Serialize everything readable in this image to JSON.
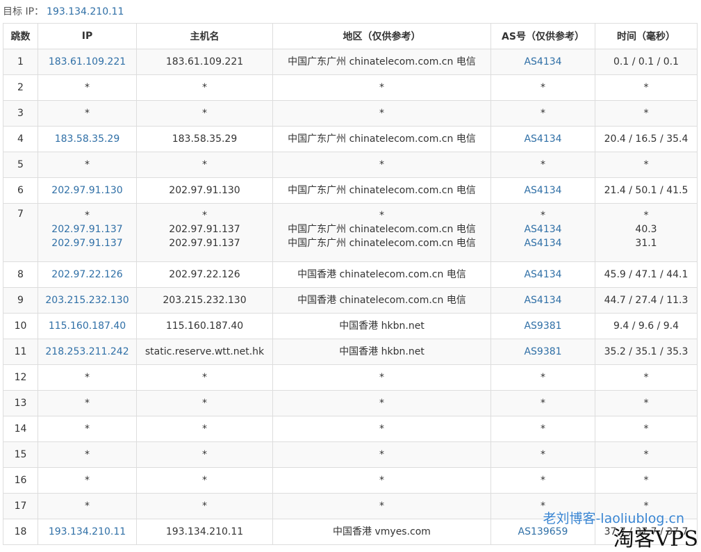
{
  "target": {
    "label": "目标 IP：",
    "ip": "193.134.210.11"
  },
  "table": {
    "headers": [
      "跳数",
      "IP",
      "主机名",
      "地区（仅供参考）",
      "AS号（仅供参考）",
      "时间（毫秒）"
    ],
    "rows": [
      {
        "hop": "1",
        "lines": [
          {
            "ip": "183.61.109.221",
            "host": "183.61.109.221",
            "region": "中国广东广州 chinatelecom.com.cn 电信",
            "as": "AS4134",
            "time": "0.1 / 0.1 / 0.1"
          }
        ]
      },
      {
        "hop": "2",
        "lines": [
          {
            "ip": "*",
            "host": "*",
            "region": "*",
            "as": "*",
            "time": "*"
          }
        ]
      },
      {
        "hop": "3",
        "lines": [
          {
            "ip": "*",
            "host": "*",
            "region": "*",
            "as": "*",
            "time": "*"
          }
        ]
      },
      {
        "hop": "4",
        "lines": [
          {
            "ip": "183.58.35.29",
            "host": "183.58.35.29",
            "region": "中国广东广州 chinatelecom.com.cn 电信",
            "as": "AS4134",
            "time": "20.4 / 16.5 / 35.4"
          }
        ]
      },
      {
        "hop": "5",
        "lines": [
          {
            "ip": "*",
            "host": "*",
            "region": "*",
            "as": "*",
            "time": "*"
          }
        ]
      },
      {
        "hop": "6",
        "lines": [
          {
            "ip": "202.97.91.130",
            "host": "202.97.91.130",
            "region": "中国广东广州 chinatelecom.com.cn 电信",
            "as": "AS4134",
            "time": "21.4 / 50.1 / 41.5"
          }
        ]
      },
      {
        "hop": "7",
        "lines": [
          {
            "ip": "*",
            "host": "*",
            "region": "*",
            "as": "*",
            "time": "*"
          },
          {
            "ip": "202.97.91.137",
            "host": "202.97.91.137",
            "region": "中国广东广州 chinatelecom.com.cn 电信",
            "as": "AS4134",
            "time": "40.3"
          },
          {
            "ip": "202.97.91.137",
            "host": "202.97.91.137",
            "region": "中国广东广州 chinatelecom.com.cn 电信",
            "as": "AS4134",
            "time": "31.1"
          }
        ]
      },
      {
        "hop": "8",
        "lines": [
          {
            "ip": "202.97.22.126",
            "host": "202.97.22.126",
            "region": "中国香港 chinatelecom.com.cn 电信",
            "as": "AS4134",
            "time": "45.9 / 47.1 / 44.1"
          }
        ]
      },
      {
        "hop": "9",
        "lines": [
          {
            "ip": "203.215.232.130",
            "host": "203.215.232.130",
            "region": "中国香港 chinatelecom.com.cn 电信",
            "as": "AS4134",
            "time": "44.7 / 27.4 / 11.3"
          }
        ]
      },
      {
        "hop": "10",
        "lines": [
          {
            "ip": "115.160.187.40",
            "host": "115.160.187.40",
            "region": "中国香港 hkbn.net",
            "as": "AS9381",
            "time": "9.4 / 9.6 / 9.4"
          }
        ]
      },
      {
        "hop": "11",
        "lines": [
          {
            "ip": "218.253.211.242",
            "host": "static.reserve.wtt.net.hk",
            "region": "中国香港 hkbn.net",
            "as": "AS9381",
            "time": "35.2 / 35.1 / 35.3"
          }
        ]
      },
      {
        "hop": "12",
        "lines": [
          {
            "ip": "*",
            "host": "*",
            "region": "*",
            "as": "*",
            "time": "*"
          }
        ]
      },
      {
        "hop": "13",
        "lines": [
          {
            "ip": "*",
            "host": "*",
            "region": "*",
            "as": "*",
            "time": "*"
          }
        ]
      },
      {
        "hop": "14",
        "lines": [
          {
            "ip": "*",
            "host": "*",
            "region": "*",
            "as": "*",
            "time": "*"
          }
        ]
      },
      {
        "hop": "15",
        "lines": [
          {
            "ip": "*",
            "host": "*",
            "region": "*",
            "as": "*",
            "time": "*"
          }
        ]
      },
      {
        "hop": "16",
        "lines": [
          {
            "ip": "*",
            "host": "*",
            "region": "*",
            "as": "*",
            "time": "*"
          }
        ]
      },
      {
        "hop": "17",
        "lines": [
          {
            "ip": "*",
            "host": "*",
            "region": "*",
            "as": "*",
            "time": "*"
          }
        ]
      },
      {
        "hop": "18",
        "lines": [
          {
            "ip": "193.134.210.11",
            "host": "193.134.210.11",
            "region": "中国香港 vmyes.com",
            "as": "AS139659",
            "time": "37.7 / 37.7 / 37.7"
          }
        ]
      }
    ]
  },
  "watermark": {
    "blog": "老刘博客-laoliublog.cn",
    "brand": "淘客VPS"
  },
  "colors": {
    "link": "#2f6fa6",
    "text": "#333333",
    "border": "#dddddd",
    "stripe": "#f9f9f9",
    "watermark_blue": "#2f7fd0"
  }
}
